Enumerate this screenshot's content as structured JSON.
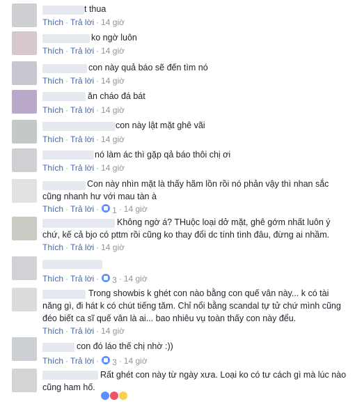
{
  "labels": {
    "like": "Thích",
    "reply": "Trả lời",
    "sep": "·"
  },
  "comments": [
    {
      "text": "t thua",
      "time": "14 giờ",
      "avatar_color": "#cfcfd3"
    },
    {
      "text": "ko ngờ luôn",
      "time": "14 giờ",
      "avatar_color": "#d6c8cc"
    },
    {
      "text": "con này quả báo sẽ đến tìm nó",
      "time": "14 giờ",
      "avatar_color": "#c9c6cf"
    },
    {
      "text": "ăn cháo đá bát",
      "time": "14 giờ",
      "avatar_color": "#b9a8c9"
    },
    {
      "text": "con này lật mặt ghê vãi",
      "time": "14 giờ",
      "avatar_color": "#c3c9c9"
    },
    {
      "text": "nó làm ác thì gặp qả báo thôi chị ơi",
      "time": "14 giờ",
      "avatar_color": "#d0d0d4"
    },
    {
      "lines": [
        "Con này nhìn mặt là thấy hãm lồn rồi nó phản vậy thì nhan sắc",
        "cũng nhanh hư với mau tàn à"
      ],
      "time": "14 giờ",
      "reactions": "1",
      "avatar_color": "#e2e2e2"
    },
    {
      "lines": [
        "Không ngờ á? THuộc loại dở mặt, ghê gớm nhất luôn ý",
        "chứ, kế cả bjo có pttm rồi cũng ko thay đổi dc tính tình đâu, đừng ai nhầm."
      ],
      "time": "14 giờ",
      "avatar_color": "#c8ccc4"
    },
    {
      "text": "",
      "time": "14 giờ",
      "reactions": "3",
      "avatar_color": "#d2d2d6"
    },
    {
      "lines": [
        "Trong showbis k ghét con nào bằng con quế vân này... k có tài",
        "năng gì, đi hát k có chút tiếng tăm. Chỉ nổi bằng scandal tự tử chứ mình cũng",
        "đéo biết ca sĩ quế vân là ai... bao nhiêu vụ toàn thấy con này đểu."
      ],
      "time": "14 giờ",
      "avatar_color": "#dcdcdc"
    },
    {
      "text": "con đó láo thế chị nhờ :))",
      "time": "14 giờ",
      "reactions": "3",
      "avatar_color": "#cccfd3"
    },
    {
      "lines": [
        "Rất ghét con này từ ngày xưa. Loại ko có tư cách gì mà lúc nào",
        "cũng ham hố."
      ],
      "avatar_color": "#d5d3d3"
    }
  ]
}
